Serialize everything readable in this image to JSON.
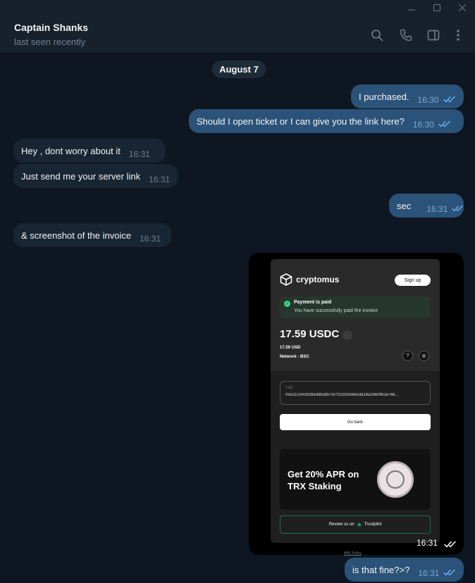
{
  "header": {
    "name": "Captain Shanks",
    "status": "last seen recently"
  },
  "date_label": "August 7",
  "messages": [
    {
      "text": "I purchased.",
      "time": "16:30"
    },
    {
      "text": "Should I open ticket or I can give you the link here?",
      "time": "16:30"
    },
    {
      "text": "Hey , dont worry about it",
      "time": "16:31"
    },
    {
      "text": "Just send me your server link",
      "time": "16:31"
    },
    {
      "text": "sec",
      "time": "16:31"
    },
    {
      "text": "& screenshot of the invoice",
      "time": "16:31"
    },
    {
      "text": "is that fine?>?",
      "time": "16:31"
    }
  ],
  "photo": {
    "time": "16:31",
    "brand": "cryptomus",
    "signup": "Sign up",
    "paid_title": "Payment is paid",
    "paid_sub": "You have successfully paid the invoice",
    "amount": "17.59 USDC",
    "usd": "17.59 USD",
    "network": "Network - BSC",
    "txid_label": "TxID",
    "txid_value": "0x521c542839a36b2d0787f1193359ecda18a29e0f62a76d...",
    "go_back": "Go back",
    "promo_text": "Get 20% APR on TRX Staking",
    "review": "Review us on",
    "trustpilot": "Trustpilot",
    "aml": "AML Policy"
  },
  "icons": {
    "search": "search-icon",
    "phone": "phone-icon",
    "sidebar": "sidebar-icon",
    "more": "more-vertical-icon"
  },
  "colors": {
    "background": "#0e1621",
    "header": "#17212b",
    "outgoing": "#2b5278",
    "incoming": "#182533",
    "check": "#6ab3f3"
  }
}
